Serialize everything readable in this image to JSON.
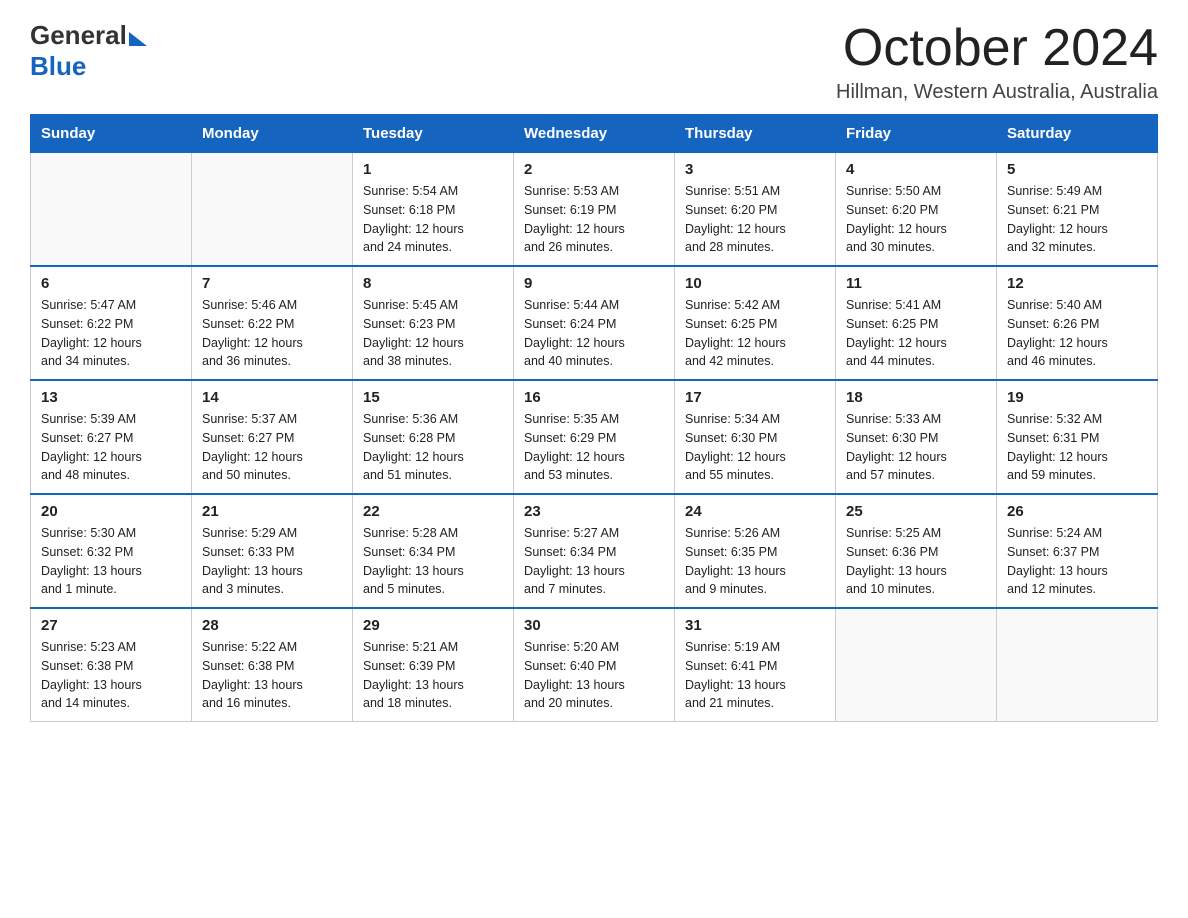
{
  "logo": {
    "general": "General",
    "blue": "Blue"
  },
  "title": {
    "month": "October 2024",
    "location": "Hillman, Western Australia, Australia"
  },
  "weekdays": [
    "Sunday",
    "Monday",
    "Tuesday",
    "Wednesday",
    "Thursday",
    "Friday",
    "Saturday"
  ],
  "weeks": [
    [
      {
        "day": "",
        "info": ""
      },
      {
        "day": "",
        "info": ""
      },
      {
        "day": "1",
        "info": "Sunrise: 5:54 AM\nSunset: 6:18 PM\nDaylight: 12 hours\nand 24 minutes."
      },
      {
        "day": "2",
        "info": "Sunrise: 5:53 AM\nSunset: 6:19 PM\nDaylight: 12 hours\nand 26 minutes."
      },
      {
        "day": "3",
        "info": "Sunrise: 5:51 AM\nSunset: 6:20 PM\nDaylight: 12 hours\nand 28 minutes."
      },
      {
        "day": "4",
        "info": "Sunrise: 5:50 AM\nSunset: 6:20 PM\nDaylight: 12 hours\nand 30 minutes."
      },
      {
        "day": "5",
        "info": "Sunrise: 5:49 AM\nSunset: 6:21 PM\nDaylight: 12 hours\nand 32 minutes."
      }
    ],
    [
      {
        "day": "6",
        "info": "Sunrise: 5:47 AM\nSunset: 6:22 PM\nDaylight: 12 hours\nand 34 minutes."
      },
      {
        "day": "7",
        "info": "Sunrise: 5:46 AM\nSunset: 6:22 PM\nDaylight: 12 hours\nand 36 minutes."
      },
      {
        "day": "8",
        "info": "Sunrise: 5:45 AM\nSunset: 6:23 PM\nDaylight: 12 hours\nand 38 minutes."
      },
      {
        "day": "9",
        "info": "Sunrise: 5:44 AM\nSunset: 6:24 PM\nDaylight: 12 hours\nand 40 minutes."
      },
      {
        "day": "10",
        "info": "Sunrise: 5:42 AM\nSunset: 6:25 PM\nDaylight: 12 hours\nand 42 minutes."
      },
      {
        "day": "11",
        "info": "Sunrise: 5:41 AM\nSunset: 6:25 PM\nDaylight: 12 hours\nand 44 minutes."
      },
      {
        "day": "12",
        "info": "Sunrise: 5:40 AM\nSunset: 6:26 PM\nDaylight: 12 hours\nand 46 minutes."
      }
    ],
    [
      {
        "day": "13",
        "info": "Sunrise: 5:39 AM\nSunset: 6:27 PM\nDaylight: 12 hours\nand 48 minutes."
      },
      {
        "day": "14",
        "info": "Sunrise: 5:37 AM\nSunset: 6:27 PM\nDaylight: 12 hours\nand 50 minutes."
      },
      {
        "day": "15",
        "info": "Sunrise: 5:36 AM\nSunset: 6:28 PM\nDaylight: 12 hours\nand 51 minutes."
      },
      {
        "day": "16",
        "info": "Sunrise: 5:35 AM\nSunset: 6:29 PM\nDaylight: 12 hours\nand 53 minutes."
      },
      {
        "day": "17",
        "info": "Sunrise: 5:34 AM\nSunset: 6:30 PM\nDaylight: 12 hours\nand 55 minutes."
      },
      {
        "day": "18",
        "info": "Sunrise: 5:33 AM\nSunset: 6:30 PM\nDaylight: 12 hours\nand 57 minutes."
      },
      {
        "day": "19",
        "info": "Sunrise: 5:32 AM\nSunset: 6:31 PM\nDaylight: 12 hours\nand 59 minutes."
      }
    ],
    [
      {
        "day": "20",
        "info": "Sunrise: 5:30 AM\nSunset: 6:32 PM\nDaylight: 13 hours\nand 1 minute."
      },
      {
        "day": "21",
        "info": "Sunrise: 5:29 AM\nSunset: 6:33 PM\nDaylight: 13 hours\nand 3 minutes."
      },
      {
        "day": "22",
        "info": "Sunrise: 5:28 AM\nSunset: 6:34 PM\nDaylight: 13 hours\nand 5 minutes."
      },
      {
        "day": "23",
        "info": "Sunrise: 5:27 AM\nSunset: 6:34 PM\nDaylight: 13 hours\nand 7 minutes."
      },
      {
        "day": "24",
        "info": "Sunrise: 5:26 AM\nSunset: 6:35 PM\nDaylight: 13 hours\nand 9 minutes."
      },
      {
        "day": "25",
        "info": "Sunrise: 5:25 AM\nSunset: 6:36 PM\nDaylight: 13 hours\nand 10 minutes."
      },
      {
        "day": "26",
        "info": "Sunrise: 5:24 AM\nSunset: 6:37 PM\nDaylight: 13 hours\nand 12 minutes."
      }
    ],
    [
      {
        "day": "27",
        "info": "Sunrise: 5:23 AM\nSunset: 6:38 PM\nDaylight: 13 hours\nand 14 minutes."
      },
      {
        "day": "28",
        "info": "Sunrise: 5:22 AM\nSunset: 6:38 PM\nDaylight: 13 hours\nand 16 minutes."
      },
      {
        "day": "29",
        "info": "Sunrise: 5:21 AM\nSunset: 6:39 PM\nDaylight: 13 hours\nand 18 minutes."
      },
      {
        "day": "30",
        "info": "Sunrise: 5:20 AM\nSunset: 6:40 PM\nDaylight: 13 hours\nand 20 minutes."
      },
      {
        "day": "31",
        "info": "Sunrise: 5:19 AM\nSunset: 6:41 PM\nDaylight: 13 hours\nand 21 minutes."
      },
      {
        "day": "",
        "info": ""
      },
      {
        "day": "",
        "info": ""
      }
    ]
  ],
  "colors": {
    "header_bg": "#1565c0",
    "header_text": "#ffffff",
    "border": "#1565c0",
    "cell_border": "#cccccc"
  }
}
